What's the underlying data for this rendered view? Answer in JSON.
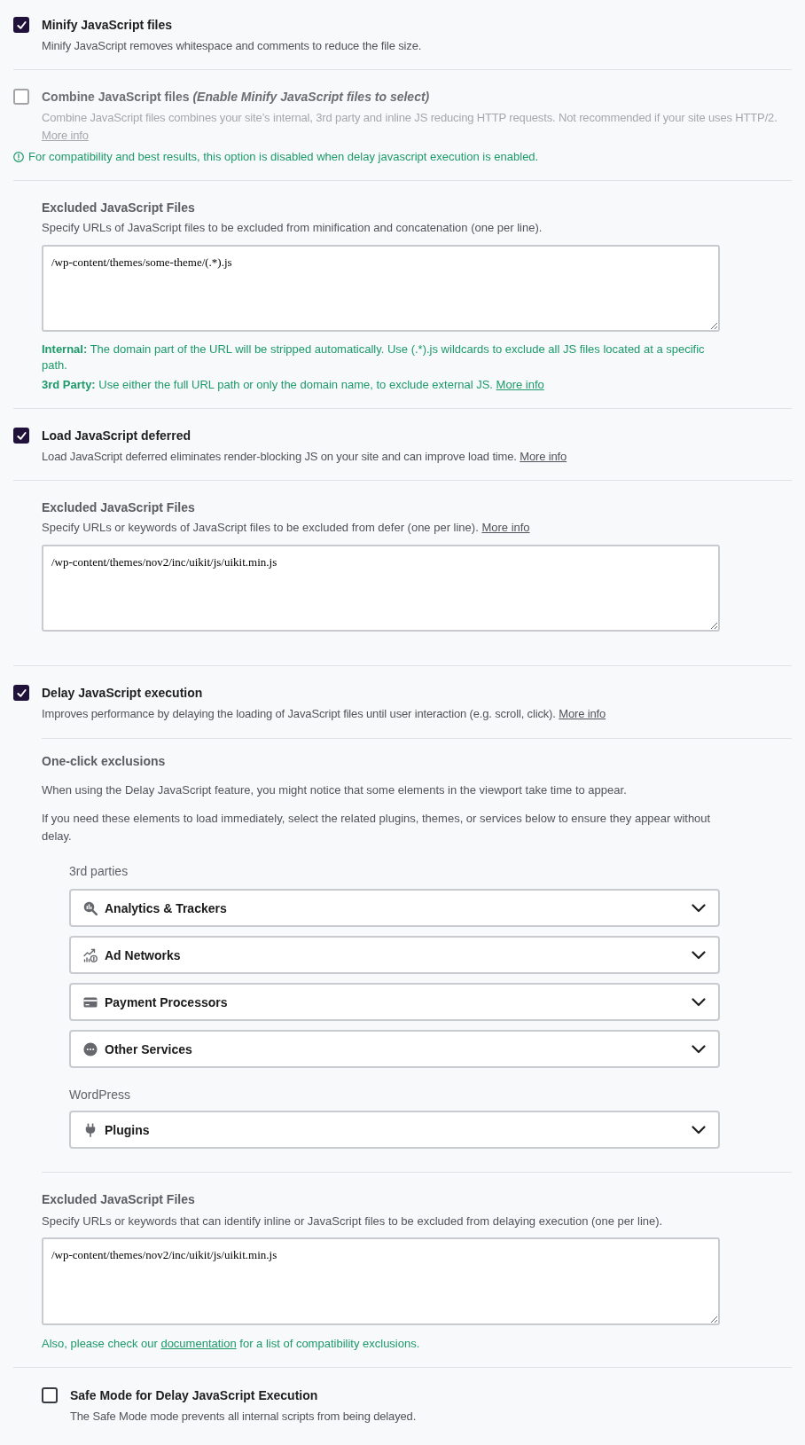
{
  "sections": [
    {
      "kind": "option",
      "label": "Minify JavaScript files",
      "checked": true,
      "disabled": false,
      "description": "Minify JavaScript removes whitespace and comments to reduce the file size."
    },
    {
      "kind": "option",
      "label": "Combine JavaScript files",
      "note": "(Enable Minify JavaScript files to select)",
      "checked": false,
      "disabled": true,
      "description": "Combine JavaScript files combines your site’s internal, 3rd party and inline JS reducing HTTP requests. Not recommended if your site uses HTTP/2.",
      "link": "More info",
      "warning": "For compatibility and best results, this option is disabled when delay javascript execution is enabled."
    },
    {
      "kind": "exclusions",
      "heading": "Excluded JavaScript Files",
      "description": "Specify URLs of JavaScript files to be excluded from minification and concatenation (one per line).",
      "value": "/wp-content/themes/some-theme/(.*).js",
      "help": [
        {
          "lead": "Internal:",
          "text": "The domain part of the URL will be stripped automatically. Use (.*).js wildcards to exclude all JS files located at a specific path."
        },
        {
          "lead": "3rd Party:",
          "text": "Use either the full URL path or only the domain name, to exclude external JS.",
          "link": "More info"
        }
      ]
    },
    {
      "kind": "option",
      "label": "Load JavaScript deferred",
      "checked": true,
      "disabled": false,
      "description": "Load JavaScript deferred eliminates render-blocking JS on your site and can improve load time.",
      "link": "More info"
    },
    {
      "kind": "exclusions",
      "heading": "Excluded JavaScript Files",
      "description": "Specify URLs or keywords of JavaScript files to be excluded from defer (one per line).",
      "link": "More info",
      "value": "/wp-content/themes/nov2/inc/uikit/js/uikit.min.js"
    },
    {
      "kind": "option",
      "label": "Delay JavaScript execution",
      "checked": true,
      "disabled": false,
      "description": "Improves performance by delaying the loading of JavaScript files until user interaction (e.g. scroll, click).",
      "link": "More info",
      "children": [
        {
          "kind": "one_click",
          "heading": "One-click exclusions",
          "paragraphs": [
            "When using the Delay JavaScript feature, you might notice that some elements in the viewport take time to appear.",
            "If you need these elements to load immediately, select the related plugins, themes, or services below to ensure they appear without delay."
          ],
          "groups": [
            {
              "title": "3rd parties",
              "items": [
                {
                  "label": "Analytics & Trackers",
                  "expanded": false
                },
                {
                  "label": "Ad Networks",
                  "expanded": false
                },
                {
                  "label": "Payment Processors",
                  "expanded": false
                },
                {
                  "label": "Other Services",
                  "expanded": false
                }
              ]
            },
            {
              "title": "WordPress",
              "items": [
                {
                  "label": "Plugins",
                  "expanded": false
                }
              ]
            }
          ]
        },
        {
          "kind": "exclusions",
          "heading": "Excluded JavaScript Files",
          "description": "Specify URLs or keywords that can identify inline or JavaScript files to be excluded from delaying execution (one per line).",
          "value": "/wp-content/themes/nov2/inc/uikit/js/uikit.min.js",
          "footer": {
            "before": "Also, please check our",
            "link": "documentation",
            "after": "for a list of compatibility exclusions."
          }
        }
      ]
    },
    {
      "kind": "sub_option",
      "label": "Safe Mode for Delay JavaScript Execution",
      "checked": false,
      "disabled": false,
      "description": "The Safe Mode mode prevents all internal scripts from being delayed."
    }
  ]
}
